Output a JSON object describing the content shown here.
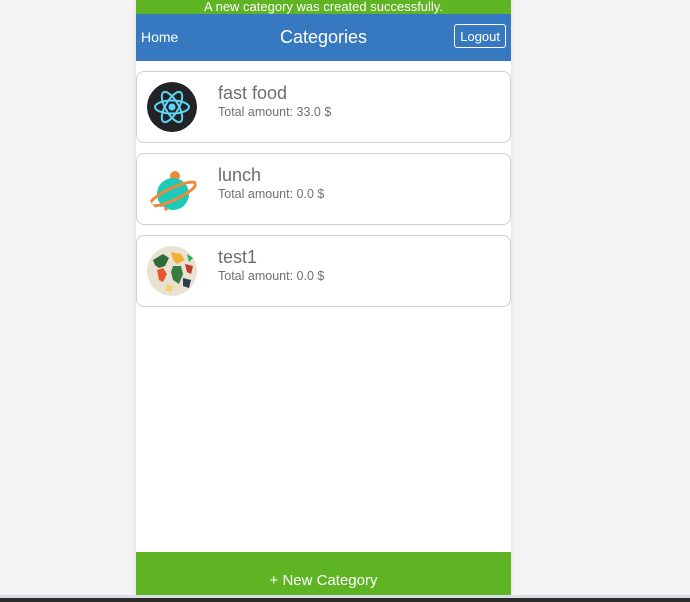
{
  "flash": {
    "message": "A new category was created successfully."
  },
  "navbar": {
    "home_label": "Home",
    "title": "Categories",
    "logout_label": "Logout",
    "color": "#3679c1"
  },
  "categories": [
    {
      "name": "fast food",
      "amount": "Total amount: 33.0 $",
      "icon": "react-atom-icon"
    },
    {
      "name": "lunch",
      "amount": "Total amount: 0.0 $",
      "icon": "planet-icon"
    },
    {
      "name": "test1",
      "amount": "Total amount: 0.0 $",
      "icon": "world-map-icon"
    }
  ],
  "footer": {
    "new_category_label": "+ New Category",
    "color": "#5eb423"
  }
}
